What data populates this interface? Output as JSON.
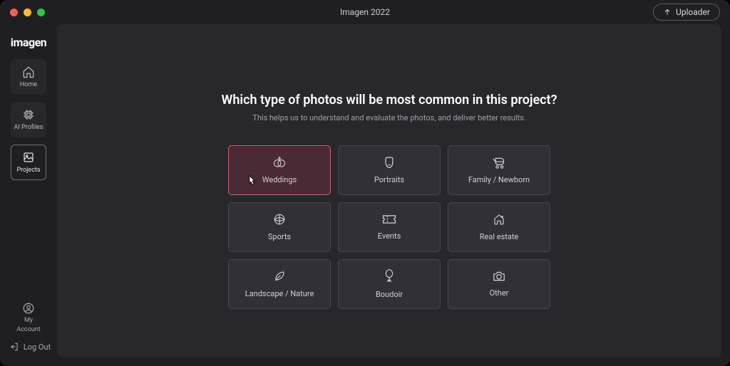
{
  "titlebar": {
    "title": "Imagen 2022",
    "uploader": "Uploader"
  },
  "logo": "imagen",
  "sidebar": {
    "home": "Home",
    "ai_profiles": "AI Profiles",
    "projects": "Projects",
    "my_account_1": "My",
    "my_account_2": "Account",
    "logout": "Log Out"
  },
  "main": {
    "heading": "Which type of photos will be most common in this project?",
    "sub": "This helps us to understand and evaluate the photos, and deliver better results."
  },
  "categories": {
    "weddings": "Weddings",
    "portraits": "Portraits",
    "family": "Family / Newborn",
    "sports": "Sports",
    "events": "Events",
    "realestate": "Real estate",
    "landscape": "Landscape / Nature",
    "boudoir": "Boudoir",
    "other": "Other"
  }
}
